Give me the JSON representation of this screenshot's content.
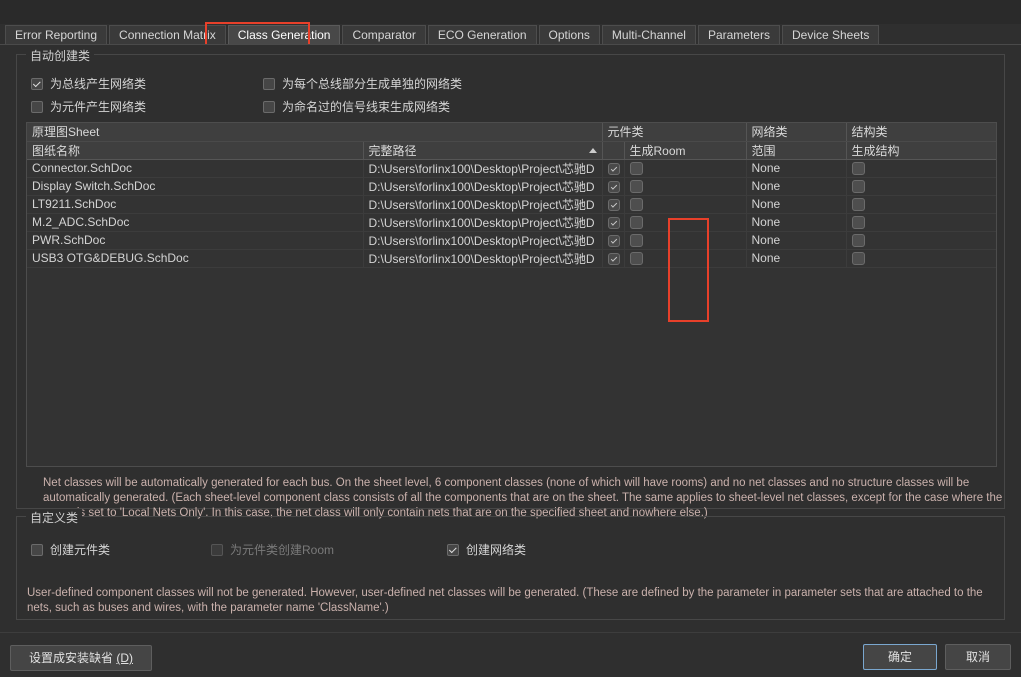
{
  "tabs": [
    {
      "label": "Error Reporting",
      "active": false
    },
    {
      "label": "Connection Matrix",
      "active": false
    },
    {
      "label": "Class Generation",
      "active": true
    },
    {
      "label": "Comparator",
      "active": false
    },
    {
      "label": "ECO Generation",
      "active": false
    },
    {
      "label": "Options",
      "active": false
    },
    {
      "label": "Multi-Channel",
      "active": false
    },
    {
      "label": "Parameters",
      "active": false
    },
    {
      "label": "Device Sheets",
      "active": false
    }
  ],
  "auto_group": {
    "legend": "自动创建类",
    "checkboxes": [
      {
        "label": "为总线产生网络类",
        "checked": true,
        "disabled": false
      },
      {
        "label": "为每个总线部分生成单独的网络类",
        "checked": false,
        "disabled": false
      },
      {
        "label": "为元件产生网络类",
        "checked": false,
        "disabled": false
      },
      {
        "label": "为命名过的信号线束生成网络类",
        "checked": false,
        "disabled": false
      }
    ],
    "description": "Net classes will be automatically generated for each bus. On the sheet level, 6 component classes (none of which will have rooms) and no net classes and no structure classes will be automatically generated. (Each sheet-level component class consists of all the components that are on the sheet. The same applies to sheet-level net classes, except for the case where the scope is set to 'Local Nets Only'. In this case, the net class will only contain nets that are on the specified sheet and nowhere else.)"
  },
  "table": {
    "group_headers": [
      {
        "label": "原理图Sheet",
        "span": 2
      },
      {
        "label": "元件类",
        "span": 2
      },
      {
        "label": "网络类",
        "span": 1
      },
      {
        "label": "结构类",
        "span": 1
      }
    ],
    "sub_headers": [
      "图纸名称",
      "完整路径",
      "",
      "生成Room",
      "范围",
      "生成结构"
    ],
    "sort_column": 1,
    "rows": [
      {
        "name": "Connector.SchDoc",
        "path": "D:\\Users\\forlinx100\\Desktop\\Project\\芯驰D",
        "component_class": true,
        "generate_room": false,
        "scope": "None",
        "generate_structure": false
      },
      {
        "name": "Display Switch.SchDoc",
        "path": "D:\\Users\\forlinx100\\Desktop\\Project\\芯驰D",
        "component_class": true,
        "generate_room": false,
        "scope": "None",
        "generate_structure": false
      },
      {
        "name": "LT9211.SchDoc",
        "path": "D:\\Users\\forlinx100\\Desktop\\Project\\芯驰D",
        "component_class": true,
        "generate_room": false,
        "scope": "None",
        "generate_structure": false
      },
      {
        "name": "M.2_ADC.SchDoc",
        "path": "D:\\Users\\forlinx100\\Desktop\\Project\\芯驰D",
        "component_class": true,
        "generate_room": false,
        "scope": "None",
        "generate_structure": false
      },
      {
        "name": "PWR.SchDoc",
        "path": "D:\\Users\\forlinx100\\Desktop\\Project\\芯驰D",
        "component_class": true,
        "generate_room": false,
        "scope": "None",
        "generate_structure": false
      },
      {
        "name": "USB3 OTG&DEBUG.SchDoc",
        "path": "D:\\Users\\forlinx100\\Desktop\\Project\\芯驰D",
        "component_class": true,
        "generate_room": false,
        "scope": "None",
        "generate_structure": false
      }
    ]
  },
  "custom_group": {
    "legend": "自定义类",
    "checkboxes": [
      {
        "label": "创建元件类",
        "checked": false,
        "disabled": false
      },
      {
        "label": "为元件类创建Room",
        "checked": false,
        "disabled": true
      },
      {
        "label": "创建网络类",
        "checked": true,
        "disabled": false
      }
    ],
    "description": "User-defined component classes will not be generated. However, user-defined net classes will be generated. (These are defined by the parameter in parameter sets that are attached to the nets, such as buses and wires, with the parameter name 'ClassName'.)"
  },
  "footer": {
    "set_default_label": "设置成安装缺省",
    "set_default_key": "(D)",
    "ok_label": "确定",
    "cancel_label": "取消"
  },
  "colors": {
    "highlight": "#e8402a",
    "dialog_bg": "#2f2f2f",
    "panel_bg": "#333333",
    "accent_focus": "#7aa7cf",
    "desc_text": "#cbb2ad"
  }
}
